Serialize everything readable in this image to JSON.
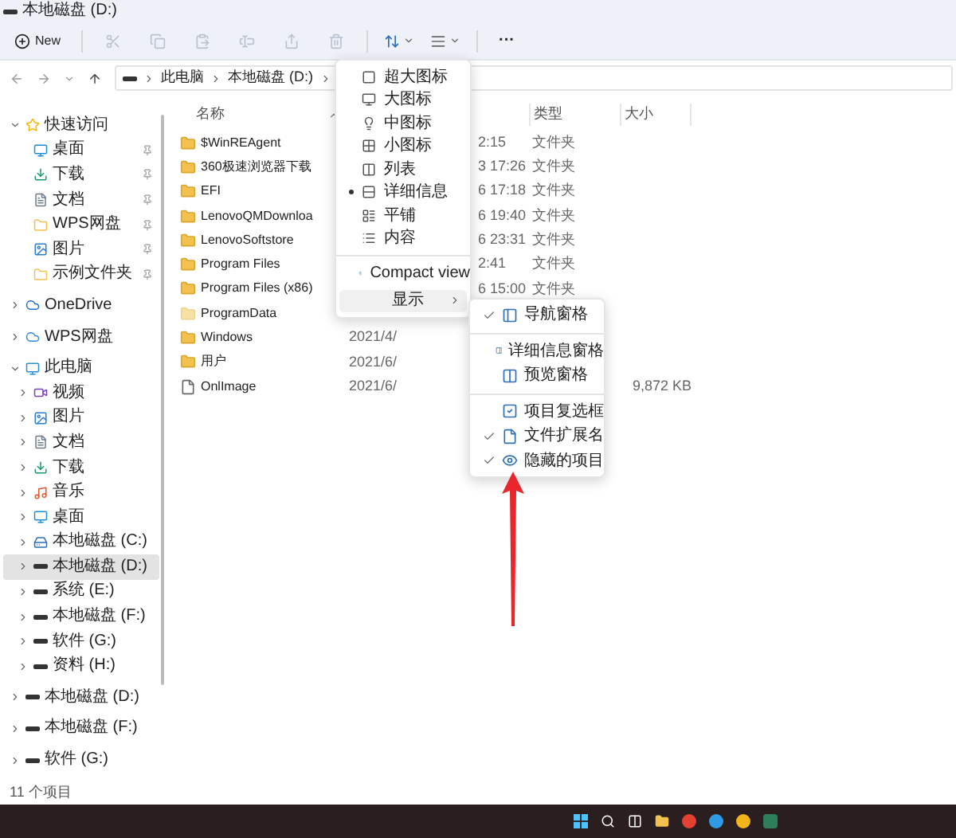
{
  "window": {
    "title": "本地磁盘 (D:)"
  },
  "toolbar": {
    "new_label": "New",
    "icon_buttons": [
      {
        "disabled": true
      },
      {
        "disabled": true
      },
      {
        "disabled": true
      },
      {
        "disabled": true
      },
      {
        "disabled": true
      },
      {
        "disabled": true
      }
    ],
    "more_label": "···"
  },
  "address_bar": {
    "segments": [
      "此电脑",
      "本地磁盘 (D:)"
    ]
  },
  "sidebar": {
    "items": [
      {
        "label": "快速访问",
        "expanded": true,
        "selected": false,
        "children": [
          {
            "label": "桌面",
            "pinned": true,
            "selected": false
          },
          {
            "label": "下载",
            "pinned": true,
            "selected": false
          },
          {
            "label": "文档",
            "pinned": true,
            "selected": false
          },
          {
            "label": "WPS网盘",
            "pinned": true,
            "selected": false
          },
          {
            "label": "图片",
            "pinned": true,
            "selected": false
          },
          {
            "label": "示例文件夹",
            "pinned": true,
            "selected": false
          }
        ]
      },
      {
        "label": "OneDrive",
        "expanded": false,
        "selected": false
      },
      {
        "label": "WPS网盘",
        "expanded": false,
        "selected": false
      },
      {
        "label": "此电脑",
        "expanded": true,
        "selected": false,
        "children": [
          {
            "label": "视频",
            "expanded": false,
            "selected": false
          },
          {
            "label": "图片",
            "expanded": false,
            "selected": false
          },
          {
            "label": "文档",
            "expanded": false,
            "selected": false
          },
          {
            "label": "下载",
            "expanded": false,
            "selected": false
          },
          {
            "label": "音乐",
            "expanded": false,
            "selected": false
          },
          {
            "label": "桌面",
            "expanded": false,
            "selected": false
          },
          {
            "label": "本地磁盘 (C:)",
            "expanded": false,
            "selected": false
          },
          {
            "label": "本地磁盘 (D:)",
            "expanded": false,
            "selected": true
          },
          {
            "label": "系统 (E:)",
            "expanded": false,
            "selected": false
          },
          {
            "label": "本地磁盘 (F:)",
            "expanded": false,
            "selected": false
          },
          {
            "label": "软件 (G:)",
            "expanded": false,
            "selected": false
          },
          {
            "label": "资料 (H:)",
            "expanded": false,
            "selected": false
          }
        ]
      },
      {
        "label": "本地磁盘 (D:)",
        "expanded": false,
        "selected": false
      },
      {
        "label": "本地磁盘 (F:)",
        "expanded": false,
        "selected": false
      },
      {
        "label": "软件 (G:)",
        "expanded": false,
        "selected": false
      }
    ]
  },
  "table": {
    "columns": [
      "名称",
      "类型",
      "大小"
    ],
    "rows": [
      {
        "name": "$WinREAgent",
        "date": "2:15",
        "type": "文件夹",
        "hidden": false
      },
      {
        "name": "360极速浏览器下载",
        "date": "3 17:26",
        "type": "文件夹",
        "hidden": false
      },
      {
        "name": "EFI",
        "date": "6 17:18",
        "type": "文件夹",
        "hidden": false
      },
      {
        "name": "LenovoQMDownloa",
        "date": "6 19:40",
        "type": "文件夹",
        "hidden": false
      },
      {
        "name": "LenovoSoftstore",
        "date": "6 23:31",
        "type": "文件夹",
        "hidden": false
      },
      {
        "name": "Program Files",
        "date": "2:41",
        "type": "文件夹",
        "hidden": false
      },
      {
        "name": "Program Files (x86)",
        "date": "6 15:00",
        "type": "文件夹",
        "hidden": false
      },
      {
        "name": "ProgramData",
        "hidden": true
      },
      {
        "name": "Windows",
        "date": "2021/4/",
        "hidden": false
      },
      {
        "name": "用户",
        "date": "2021/6/",
        "hidden": false
      },
      {
        "name": "OnlImage",
        "date": "2021/6/",
        "size": "9,872 KB",
        "hidden": false
      }
    ]
  },
  "view_menu": {
    "items": [
      {
        "kind": "option",
        "label": "超大图标",
        "selected": false
      },
      {
        "kind": "option",
        "label": "大图标",
        "selected": false
      },
      {
        "kind": "option",
        "label": "中图标",
        "selected": false
      },
      {
        "kind": "option",
        "label": "小图标",
        "selected": false
      },
      {
        "kind": "option",
        "label": "列表",
        "selected": false
      },
      {
        "kind": "option",
        "label": "详细信息",
        "selected": true
      },
      {
        "kind": "option",
        "label": "平铺",
        "selected": false
      },
      {
        "kind": "option",
        "label": "内容",
        "selected": false
      },
      {
        "kind": "separator"
      },
      {
        "kind": "option",
        "label": "Compact view",
        "selected": false
      },
      {
        "kind": "submenu",
        "label": "显示",
        "selected": true
      }
    ]
  },
  "show_submenu": {
    "items": [
      {
        "kind": "toggle",
        "label": "导航窗格",
        "checked": true
      },
      {
        "kind": "separator"
      },
      {
        "kind": "toggle",
        "label": "详细信息窗格",
        "checked": false
      },
      {
        "kind": "toggle",
        "label": "预览窗格",
        "checked": false
      },
      {
        "kind": "separator"
      },
      {
        "kind": "toggle",
        "label": "项目复选框",
        "checked": false
      },
      {
        "kind": "toggle",
        "label": "文件扩展名",
        "checked": true
      },
      {
        "kind": "toggle",
        "label": "隐藏的项目",
        "checked": true
      }
    ]
  },
  "status_bar": {
    "text": "11 个项目"
  }
}
